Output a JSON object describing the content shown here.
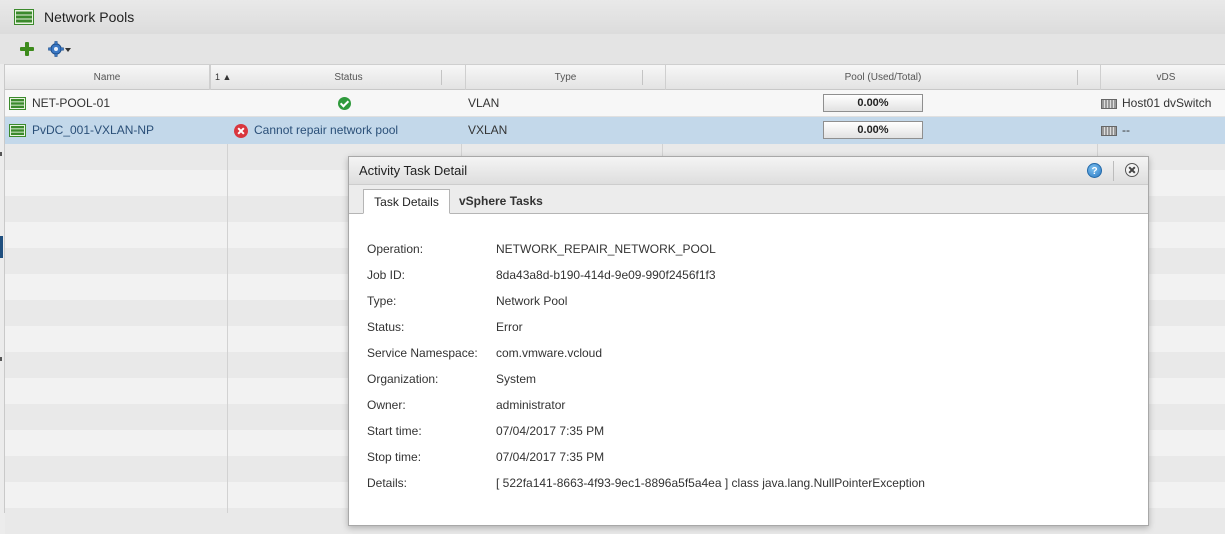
{
  "page": {
    "title": "Network Pools"
  },
  "toolbar": {
    "add_icon": "plus-icon",
    "actions_icon": "gear-icon"
  },
  "grid": {
    "columns": {
      "name": "Name",
      "sort": "1 ▲",
      "status": "Status",
      "type": "Type",
      "pool": "Pool (Used/Total)",
      "vds": "vDS"
    },
    "rows": [
      {
        "name": "NET-POOL-01",
        "status_icon": "ok-icon",
        "status_text": "",
        "type": "VLAN",
        "pool_used": "0.00%",
        "vds": "Host01 dvSwitch"
      },
      {
        "name": "PvDC_001-VXLAN-NP",
        "status_icon": "error-icon",
        "status_text": "Cannot repair network pool",
        "type": "VXLAN",
        "pool_used": "0.00%",
        "vds": "--"
      }
    ]
  },
  "dialog": {
    "title": "Activity Task Detail",
    "help_icon_text": "?",
    "tabs": [
      "Task Details",
      "vSphere Tasks"
    ],
    "details": [
      {
        "label": "Operation:",
        "value": "NETWORK_REPAIR_NETWORK_POOL"
      },
      {
        "label": "Job ID:",
        "value": "8da43a8d-b190-414d-9e09-990f2456f1f3"
      },
      {
        "label": "Type:",
        "value": "Network Pool"
      },
      {
        "label": "Status:",
        "value": "Error"
      },
      {
        "label": "Service Namespace:",
        "value": "com.vmware.vcloud"
      },
      {
        "label": "Organization:",
        "value": "System"
      },
      {
        "label": "Owner:",
        "value": "administrator"
      },
      {
        "label": "Start time:",
        "value": "07/04/2017 7:35 PM"
      },
      {
        "label": "Stop time:",
        "value": "07/04/2017 7:35 PM"
      },
      {
        "label": "Details:",
        "value": "[ 522fa141-8663-4f93-9ec1-8896a5f5a4ea ] class java.lang.NullPointerException"
      }
    ]
  },
  "colors": {
    "selected_row": "#c3d8ea",
    "ok_status": "#2f9a3c",
    "error_status": "#d9363e",
    "pool_icon": "#3b8a2c"
  }
}
